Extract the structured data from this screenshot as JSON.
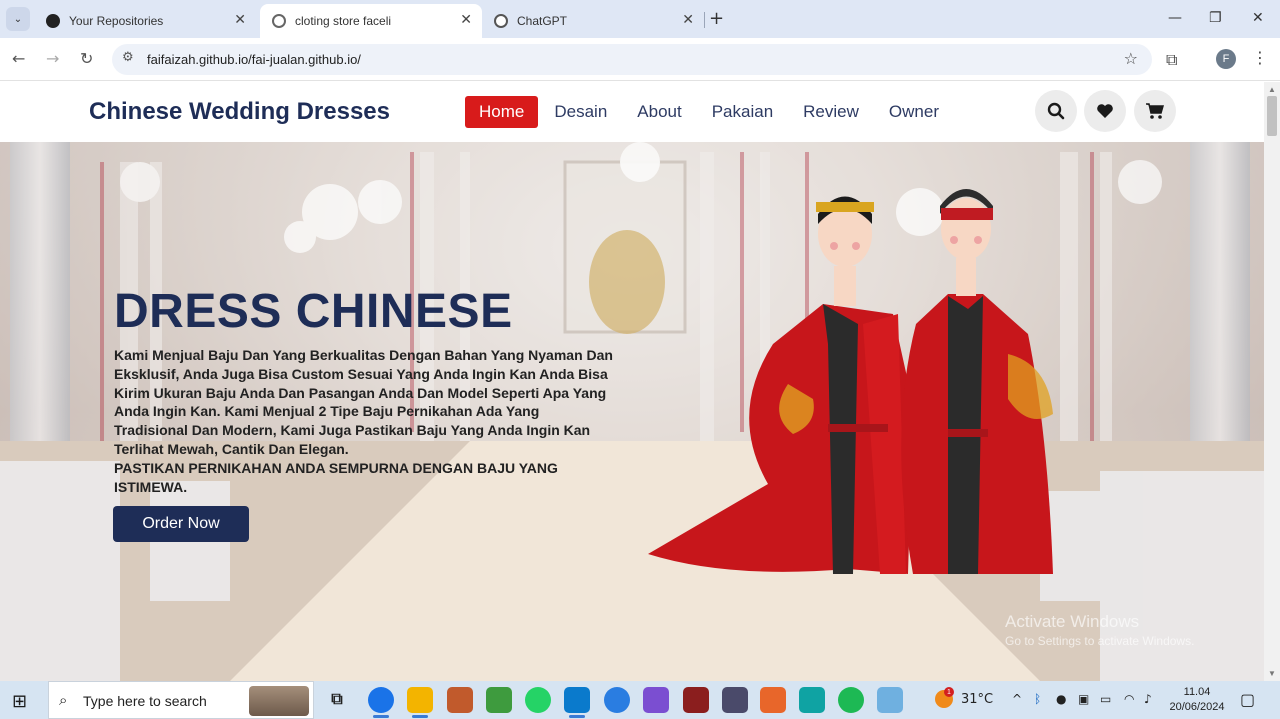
{
  "browser": {
    "tabs": [
      {
        "title": "Your Repositories",
        "active": false
      },
      {
        "title": "cloting store faceli",
        "active": true
      },
      {
        "title": "ChatGPT",
        "active": false
      }
    ],
    "url": "faifaizah.github.io/fai-jualan.github.io/",
    "profile_initial": "F"
  },
  "site": {
    "brand": "Chinese Wedding Dresses",
    "nav": [
      "Home",
      "Desain",
      "About",
      "Pakaian",
      "Review",
      "Owner"
    ],
    "active_nav": "Home",
    "hero": {
      "title": "DRESS CHINESE",
      "description": "Kami Menjual Baju Dan Yang Berkualitas Dengan Bahan Yang Nyaman Dan Eksklusif, Anda Juga Bisa Custom Sesuai Yang Anda Ingin Kan Anda Bisa Kirim Ukuran Baju Anda Dan Pasangan Anda Dan Model Seperti Apa Yang Anda Ingin Kan. Kami Menjual 2 Tipe Baju Pernikahan Ada Yang Tradisional Dan Modern, Kami Juga Pastikan Baju Yang Anda Ingin Kan Terlihat Mewah, Cantik Dan Elegan.",
      "tagline": "PASTIKAN PERNIKAHAN ANDA SEMPURNA DENGAN BAJU YANG ISTIMEWA.",
      "cta": "Order Now"
    },
    "colors": {
      "primary": "#1e2d57",
      "accent": "#d81b1b"
    }
  },
  "watermark": {
    "line1": "Activate Windows",
    "line2": "Go to Settings to activate Windows."
  },
  "taskbar": {
    "search_placeholder": "Type here to search",
    "temperature": "31°C",
    "time": "11.04",
    "date": "20/06/2024",
    "weather_badge": "1"
  }
}
